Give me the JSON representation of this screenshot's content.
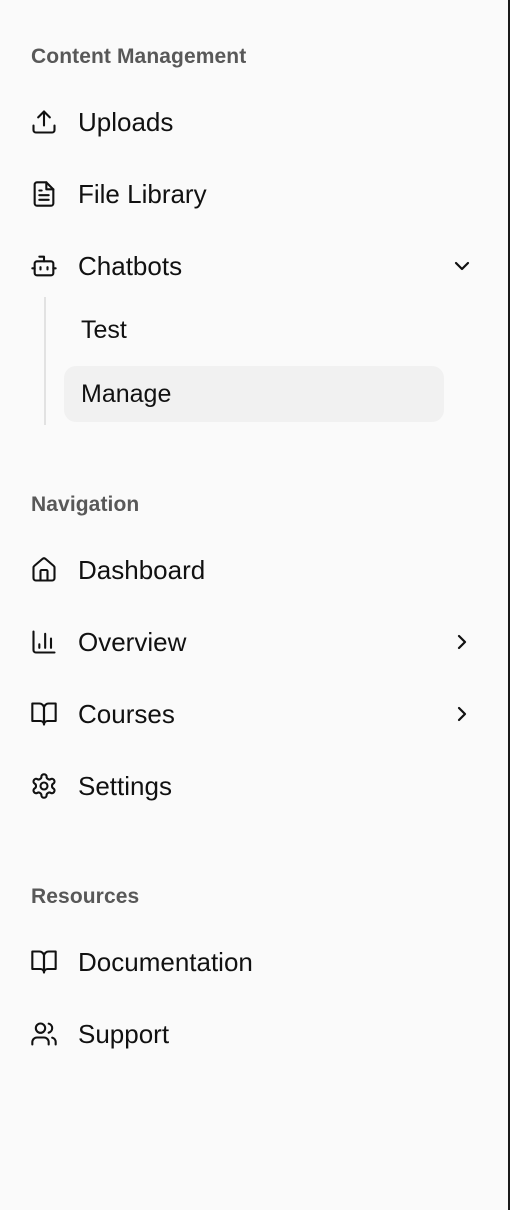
{
  "sections": {
    "content": {
      "title": "Content Management",
      "items": {
        "uploads": {
          "label": "Uploads",
          "icon": "upload-icon"
        },
        "file_library": {
          "label": "File Library",
          "icon": "file-text-icon"
        },
        "chatbots": {
          "label": "Chatbots",
          "icon": "bot-icon",
          "expanded": true,
          "children": {
            "test": {
              "label": "Test"
            },
            "manage": {
              "label": "Manage",
              "active": true
            }
          }
        }
      }
    },
    "navigation": {
      "title": "Navigation",
      "items": {
        "dashboard": {
          "label": "Dashboard",
          "icon": "home-icon"
        },
        "overview": {
          "label": "Overview",
          "icon": "bar-chart-icon",
          "has_submenu": true
        },
        "courses": {
          "label": "Courses",
          "icon": "book-open-icon",
          "has_submenu": true
        },
        "settings": {
          "label": "Settings",
          "icon": "gear-icon"
        }
      }
    },
    "resources": {
      "title": "Resources",
      "items": {
        "documentation": {
          "label": "Documentation",
          "icon": "book-open-icon"
        },
        "support": {
          "label": "Support",
          "icon": "users-icon"
        }
      }
    }
  },
  "colors": {
    "sidebar_bg": "#fafafa",
    "section_title": "#585858",
    "text": "#111111",
    "active_bg": "#f1f1f1",
    "border": "#1a1a1a"
  }
}
